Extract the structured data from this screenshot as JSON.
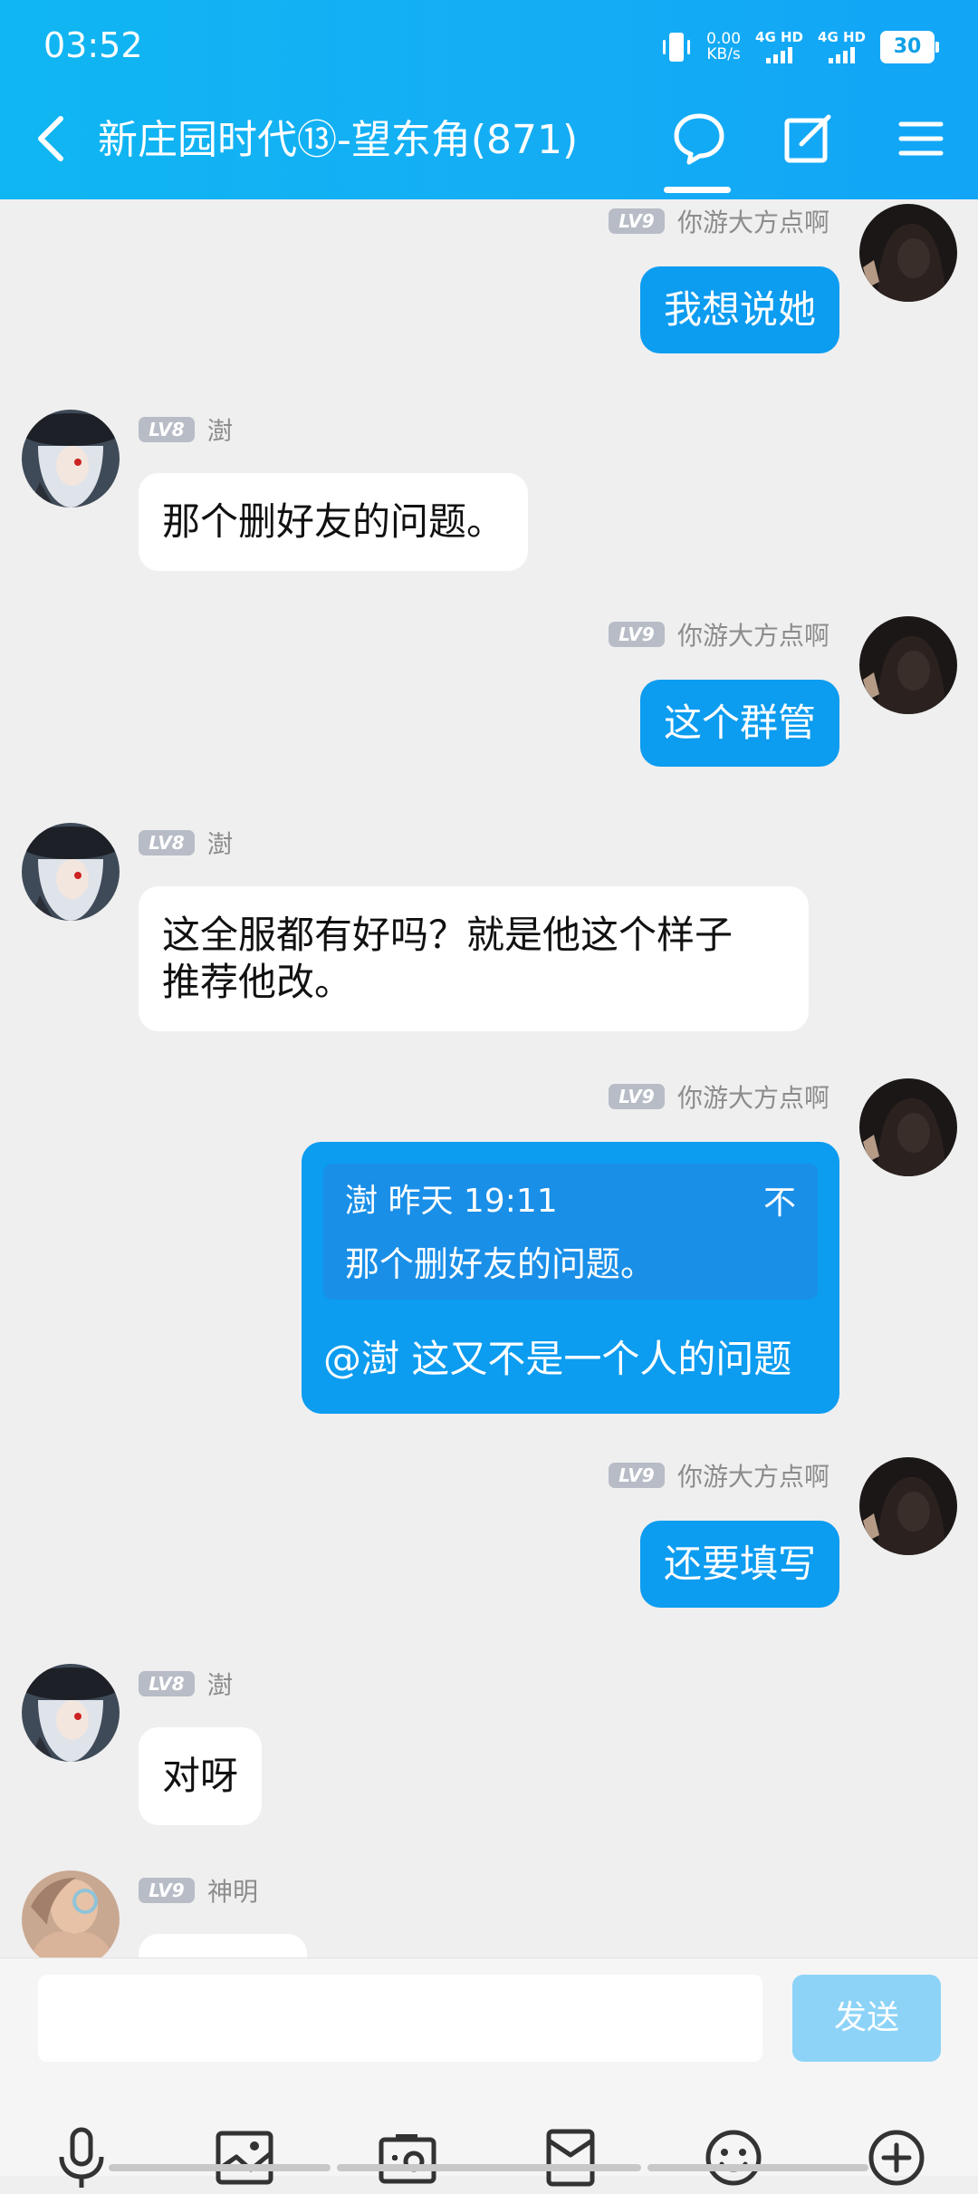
{
  "status": {
    "time": "03:52",
    "speed_value": "0.00",
    "speed_unit": "KB/s",
    "network1": "4G HD",
    "network2": "4G HD",
    "battery": "30"
  },
  "header": {
    "title": "新庄园时代⑬-望东角(871)"
  },
  "messages": [
    {
      "level": "LV9",
      "sender": "你游大方点啊",
      "text": "我想说她"
    },
    {
      "level": "LV8",
      "sender": "澍",
      "text": "那个删好友的问题。"
    },
    {
      "level": "LV9",
      "sender": "你游大方点啊",
      "text": "这个群管"
    },
    {
      "level": "LV8",
      "sender": "澍",
      "text_line1": "这全服都有好吗？就是他这个样子",
      "text_line2": "推荐他改。"
    },
    {
      "level": "LV9",
      "sender": "你游大方点啊",
      "quote_header": "澍 昨天 19:11",
      "quote_icon": "不",
      "quote_text": "那个删好友的问题。",
      "text": "@澍 这又不是一个人的问题"
    },
    {
      "level": "LV9",
      "sender": "你游大方点啊",
      "text": "还要填写"
    },
    {
      "level": "LV8",
      "sender": "澍",
      "text": "对呀"
    },
    {
      "level": "LV9",
      "sender": "神明"
    }
  ],
  "input": {
    "send_label": "发送"
  },
  "colors": {
    "header": "#12a8f4",
    "outgoing_bubble": "#0c9cf0",
    "incoming_bubble": "#ffffff",
    "background": "#efefef"
  }
}
